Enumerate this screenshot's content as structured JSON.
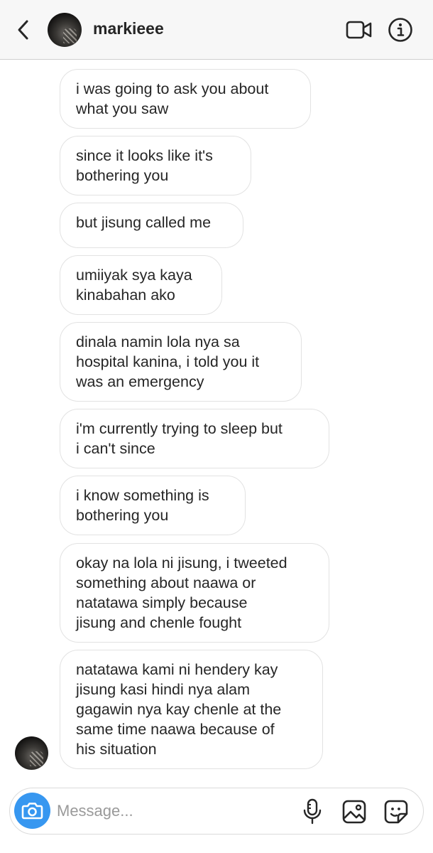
{
  "header": {
    "username": "markieee",
    "icons": {
      "back": "chevron-left-icon",
      "video": "video-camera-icon",
      "info": "info-icon"
    }
  },
  "messages": [
    {
      "text": "i was going to ask you about\nwhat you saw"
    },
    {
      "text": "since it looks like it's\nbothering you"
    },
    {
      "text": "but jisung called me"
    },
    {
      "text": "umiiyak sya kaya\nkinabahan ako"
    },
    {
      "text": "dinala namin lola nya sa\nhospital kanina, i told you it\nwas an emergency"
    },
    {
      "text": "i'm currently trying to sleep but\ni can't since"
    },
    {
      "text": "i know something is\nbothering you"
    },
    {
      "text": "okay na lola ni jisung, i tweeted\nsomething about naawa or\nnatatawa simply because\njisung and chenle fought"
    },
    {
      "text": "natatawa kami ni hendery kay\njisung kasi hindi nya alam\ngagawin nya kay chenle at the\nsame time naawa because of\nhis situation"
    }
  ],
  "composer": {
    "placeholder": "Message...",
    "icons": {
      "camera": "camera-icon",
      "mic": "microphone-icon",
      "gallery": "gallery-icon",
      "sticker": "sticker-icon"
    },
    "accent": "#3797f0"
  }
}
